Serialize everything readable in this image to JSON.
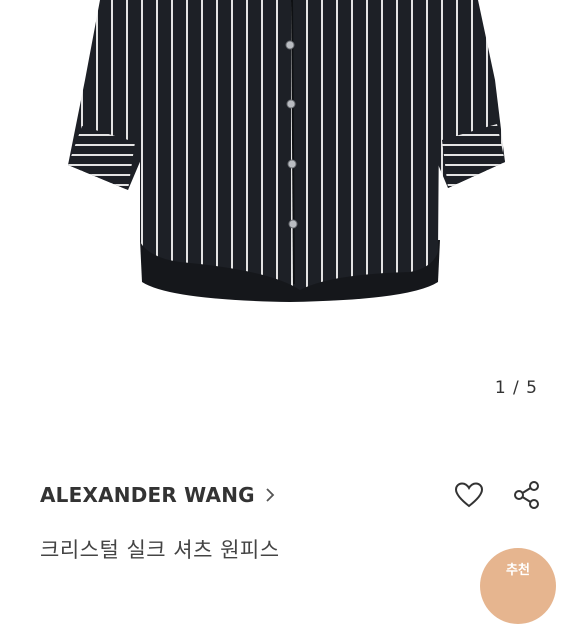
{
  "gallery": {
    "image_alt": "striped shirt dress",
    "counter": "1 / 5"
  },
  "product": {
    "brand": "ALEXANDER WANG",
    "title": "크리스털 실크 셔츠 원피스",
    "badge": "추천"
  },
  "icons": {
    "brand_chevron": "chevron-right-icon",
    "wishlist": "heart-icon",
    "share": "share-icon"
  },
  "colors": {
    "shirt": "#1d2026",
    "stripe": "#e8e8e8",
    "badge": "#e6b58f",
    "text": "#333333"
  }
}
